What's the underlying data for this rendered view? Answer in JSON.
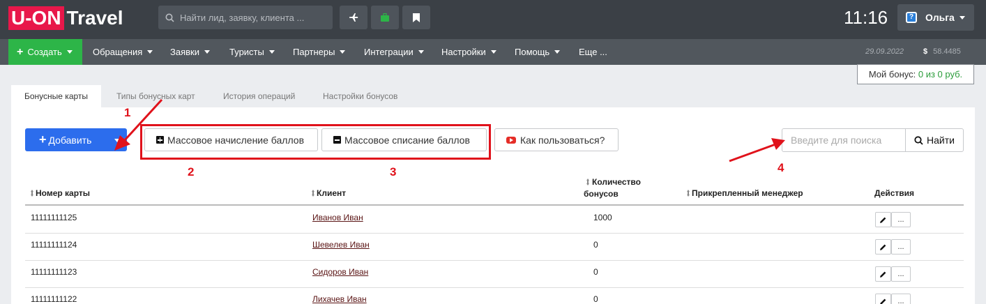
{
  "app": {
    "logo_part1": "U-ON",
    "logo_part2": "Travel"
  },
  "header": {
    "search_placeholder": "Найти лид, заявку, клиента ...",
    "time": "11:16",
    "user_name": "Ольга",
    "help_badge": "?"
  },
  "nav": {
    "create_label": "Создать",
    "items": [
      "Обращения",
      "Заявки",
      "Туристы",
      "Партнеры",
      "Интеграции",
      "Настройки",
      "Помощь"
    ],
    "more": "Еще ...",
    "date": "29.09.2022",
    "currency_symbol": "$",
    "rate": "58.4485"
  },
  "bonus": {
    "label": "Мой бонус:",
    "value": "0 из 0 руб."
  },
  "tabs": [
    "Бонусные карты",
    "Типы бонусных карт",
    "История операций",
    "Настройки бонусов"
  ],
  "toolbar": {
    "add_label": "Добавить",
    "mass_add_label": "Массовое начисление баллов",
    "mass_remove_label": "Массовое списание баллов",
    "howto_label": "Как пользоваться?",
    "search_placeholder": "Введите для поиска",
    "search_button": "Найти"
  },
  "annotations": [
    "1",
    "2",
    "3",
    "4"
  ],
  "table": {
    "columns": [
      "Номер карты",
      "Клиент",
      "Количество",
      "бонусов",
      "Прикрепленный менеджер",
      "Действия"
    ],
    "rows": [
      {
        "card": "11111111125",
        "client": "Иванов Иван",
        "bonus": "1000",
        "manager": ""
      },
      {
        "card": "11111111124",
        "client": "Шевелев Иван",
        "bonus": "0",
        "manager": ""
      },
      {
        "card": "11111111123",
        "client": "Сидоров Иван",
        "bonus": "0",
        "manager": ""
      },
      {
        "card": "11111111122",
        "client": "Лихачев Иван",
        "bonus": "0",
        "manager": ""
      }
    ],
    "action_more": "..."
  },
  "colors": {
    "accent_green": "#2db548",
    "primary_blue": "#2c6ded",
    "annotation_red": "#e0121b",
    "topbar": "#3b4046"
  }
}
